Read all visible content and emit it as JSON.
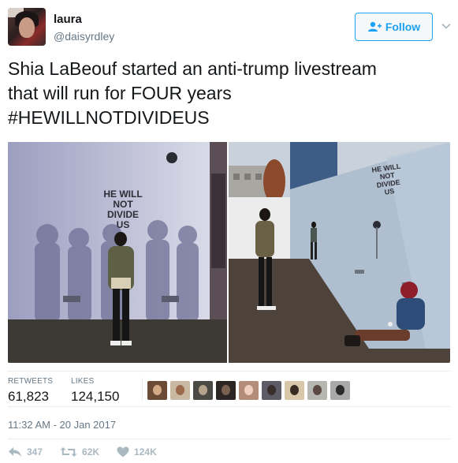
{
  "user": {
    "name": "laura",
    "handle": "@daisyrdley"
  },
  "follow_button": {
    "label": "Follow"
  },
  "tweet": {
    "lines": [
      "Shia LaBeouf started an anti-trump livestream",
      "that will run for FOUR years",
      "#HEWILLNOTDIVIDEUS"
    ]
  },
  "media": {
    "photo_left_wall_text": [
      "HE WILL",
      "NOT",
      "DIVIDE",
      "US"
    ],
    "photo_right_wall_text": [
      "HE WILL",
      "NOT",
      "DIVIDE",
      "US"
    ]
  },
  "stats": {
    "retweets_label": "RETWEETS",
    "retweets_value": "61,823",
    "likes_label": "LIKES",
    "likes_value": "124,150",
    "liker_avatar_count": 9
  },
  "timestamp": "11:32 AM - 20 Jan 2017",
  "actions": {
    "reply_count": "347",
    "retweet_count": "62K",
    "like_count": "124K"
  },
  "colors": {
    "brand_blue": "#1da1f2",
    "text_primary": "#14171a",
    "text_secondary": "#657786",
    "action_gray": "#aab8c2",
    "border": "#e6ecf0"
  }
}
